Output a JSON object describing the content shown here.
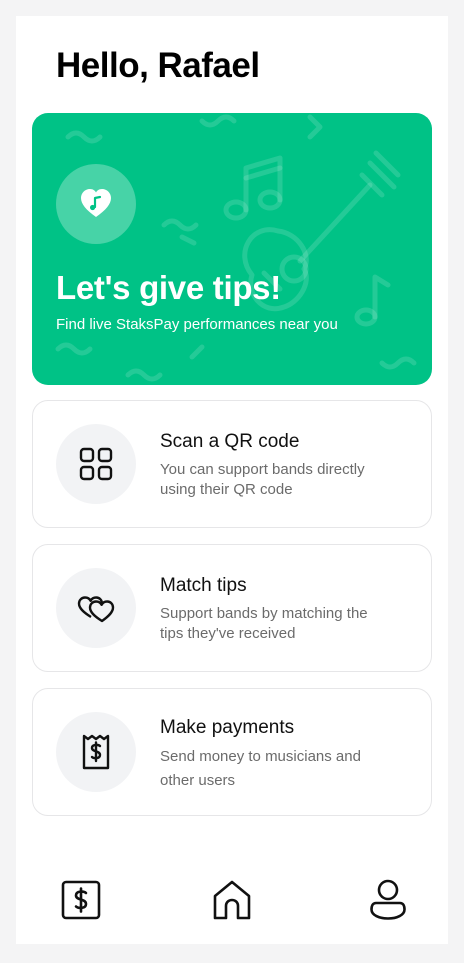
{
  "greeting": "Hello, Rafael",
  "hero": {
    "title": "Let's give tips!",
    "subtitle": "Find live StaksPay performances near you",
    "icon": "heart-music-icon",
    "background": "#00c286"
  },
  "cards": [
    {
      "title": "Scan a QR code",
      "description": "You can support bands directly\nusing their QR code",
      "icon": "qr-grid-icon"
    },
    {
      "title": "Match tips",
      "description": "Support bands  by matching the\ntips they've received",
      "icon": "two-hearts-icon"
    },
    {
      "title": "Make payments",
      "description": "Send money to musicians and\nother users",
      "icon": "receipt-dollar-icon"
    }
  ],
  "nav": [
    {
      "name": "payments",
      "icon": "dollar-square-icon"
    },
    {
      "name": "home",
      "icon": "home-icon"
    },
    {
      "name": "profile",
      "icon": "user-icon"
    }
  ]
}
